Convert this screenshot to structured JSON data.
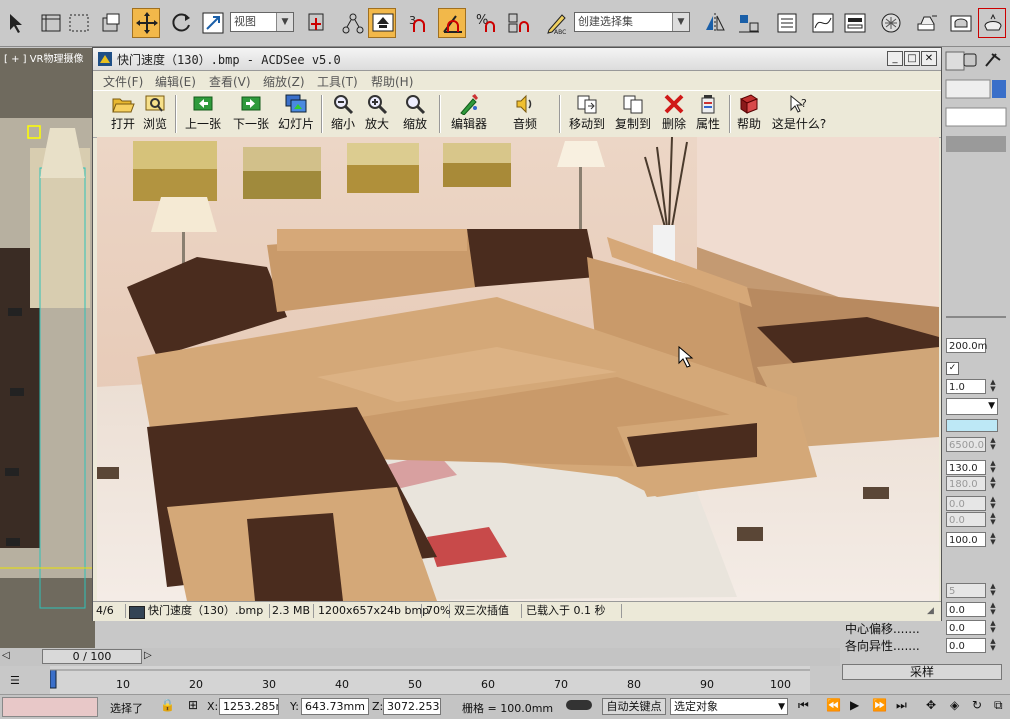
{
  "max": {
    "view_combo": "视图",
    "selection_set": "创建选择集",
    "viewport_label": "[ + ] VR物理摄像",
    "panel_fields": [
      "200.0m",
      "1.0",
      "6500.0",
      "130.0",
      "180.0",
      "0.0",
      "0.0",
      "100.0",
      "5",
      "0.0",
      "0.0",
      "0.0"
    ],
    "props": {
      "center_offset": "中心偏移.......",
      "anisotropy": "各向异性.......",
      "sample": "采样"
    },
    "timeline": {
      "position": "0 / 100",
      "ticks": [
        "10",
        "20",
        "30",
        "40",
        "50",
        "60",
        "70",
        "80",
        "90",
        "100"
      ]
    },
    "status": {
      "selected": "选择了",
      "x_label": "X:",
      "x_value": "1253.285m",
      "y_label": "Y:",
      "y_value": "643.73mm",
      "z_label": "Z:",
      "z_value": "3072.253n",
      "grid": "栅格 = 100.0mm",
      "autokey": "自动关键点",
      "selected_obj": "选定对象"
    }
  },
  "acdsee": {
    "title": "快门速度（130）.bmp - ACDSee v5.0",
    "menu": [
      "文件(F)",
      "编辑(E)",
      "查看(V)",
      "缩放(Z)",
      "工具(T)",
      "帮助(H)"
    ],
    "tools": [
      {
        "label": "打开",
        "icon": "open-folder-icon"
      },
      {
        "label": "浏览",
        "icon": "browse-icon"
      },
      {
        "label": "上一张",
        "icon": "previous-arrow-icon"
      },
      {
        "label": "下一张",
        "icon": "next-arrow-icon"
      },
      {
        "label": "幻灯片",
        "icon": "slideshow-icon"
      },
      {
        "label": "缩小",
        "icon": "zoom-out-icon"
      },
      {
        "label": "放大",
        "icon": "zoom-in-icon"
      },
      {
        "label": "缩放",
        "icon": "zoom-icon"
      },
      {
        "label": "编辑器",
        "icon": "editor-icon"
      },
      {
        "label": "音频",
        "icon": "audio-icon"
      },
      {
        "label": "移动到",
        "icon": "move-to-icon"
      },
      {
        "label": "复制到",
        "icon": "copy-to-icon"
      },
      {
        "label": "删除",
        "icon": "delete-icon"
      },
      {
        "label": "属性",
        "icon": "properties-icon"
      },
      {
        "label": "帮助",
        "icon": "help-book-icon"
      },
      {
        "label": "这是什么?",
        "icon": "whats-this-icon"
      }
    ],
    "status": {
      "index": "4/6",
      "filename": "快门速度（130）.bmp",
      "size": "2.3 MB",
      "dims": "1200x657x24b bmp",
      "zoom": "70%",
      "filter": "双三次插值",
      "load_time": "已载入于 0.1 秒"
    }
  },
  "colors": {
    "accent": "#f2b84a",
    "sofa_tan": "#c99a6a",
    "sofa_dark": "#4a2c1e"
  }
}
